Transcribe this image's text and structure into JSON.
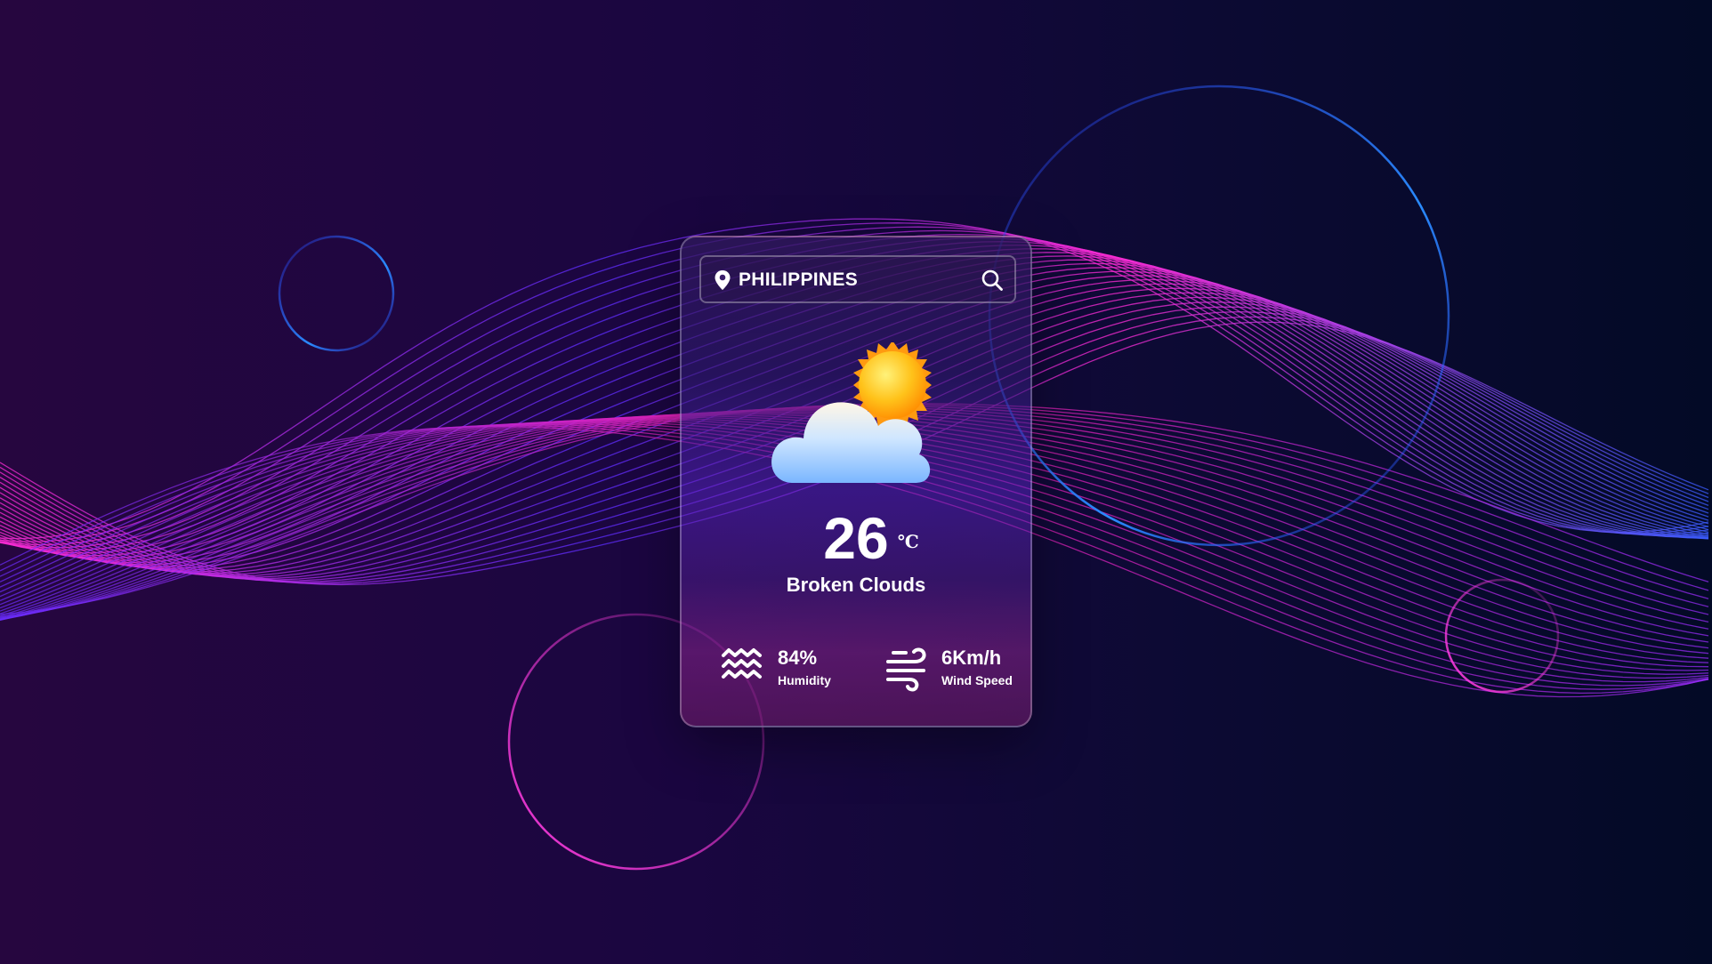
{
  "search": {
    "location": "PHILIPPINES",
    "icon": "search-icon",
    "pin_icon": "location-pin-icon"
  },
  "weather": {
    "condition_icon": "cloud-sun-icon",
    "temperature": "26",
    "unit": "℃",
    "description": "Broken Clouds"
  },
  "details": {
    "humidity": {
      "value": "84%",
      "label": "Humidity",
      "icon": "waves-icon"
    },
    "wind": {
      "value": "6Km/h",
      "label": "Wind Speed",
      "icon": "wind-icon"
    }
  },
  "colors": {
    "background_left": "#26063f",
    "background_right": "#030a26",
    "wave_magenta": "#ff2bd6",
    "wave_blue": "#3a3cff",
    "text": "#ffffff"
  }
}
